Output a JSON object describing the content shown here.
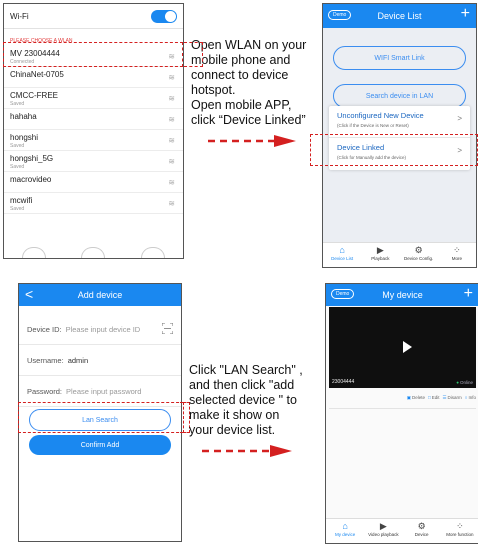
{
  "wifi_screen": {
    "title": "Wi-Fi",
    "choose_label": "PLEASE CHOOSE A WLAN",
    "networks": [
      {
        "name": "MV 23004444",
        "status": "Connected"
      },
      {
        "name": "ChinaNet-0705",
        "status": ""
      },
      {
        "name": "CMCC-FREE",
        "status": "Saved"
      },
      {
        "name": "hahaha",
        "status": ""
      },
      {
        "name": "hongshi",
        "status": "Saved"
      },
      {
        "name": "hongshi_5G",
        "status": "Saved"
      },
      {
        "name": "macrovideo",
        "status": ""
      },
      {
        "name": "mcwifi",
        "status": "Saved"
      }
    ]
  },
  "instructions": {
    "step1": [
      "Open WLAN on your",
      "mobile phone and",
      "connect to device",
      "hotspot.",
      "Open mobile APP,",
      "click “Device Linked”"
    ],
    "step2": [
      "Click \"LAN Search\" ,",
      "and then click \"add",
      "selected device \" to",
      "make it show on",
      "your device list."
    ]
  },
  "device_list_screen": {
    "demo": "Demo",
    "title": "Device List",
    "wifi_smart_link": "WIFI Smart Link",
    "search_lan": "Search device in LAN",
    "popup": [
      {
        "title": "Unconfigured New Device",
        "sub": "(Click if the Device is New or Reset)"
      },
      {
        "title": "Device Linked",
        "sub": "(Click for Manually add the device)"
      }
    ],
    "tabs": [
      "Device List",
      "Playback",
      "Device Config.",
      "More"
    ]
  },
  "add_device_screen": {
    "title": "Add device",
    "device_id_label": "Device ID:",
    "device_id_placeholder": "Please input device ID",
    "username_label": "Username:",
    "username_value": "admin",
    "password_label": "Password:",
    "password_placeholder": "Please input password",
    "lan_search": "Lan Search",
    "confirm_add": "Confirm Add"
  },
  "my_device_screen": {
    "demo": "Demo",
    "title": "My device",
    "device_id": "23004444",
    "status": "Online",
    "actions": [
      "Delete",
      "Edit",
      "Disarm",
      "Info"
    ],
    "tabs": [
      "My device",
      "Video playback",
      "Device",
      "More function"
    ]
  },
  "colors": {
    "accent": "#1a88f0",
    "highlight": "#d42020"
  }
}
